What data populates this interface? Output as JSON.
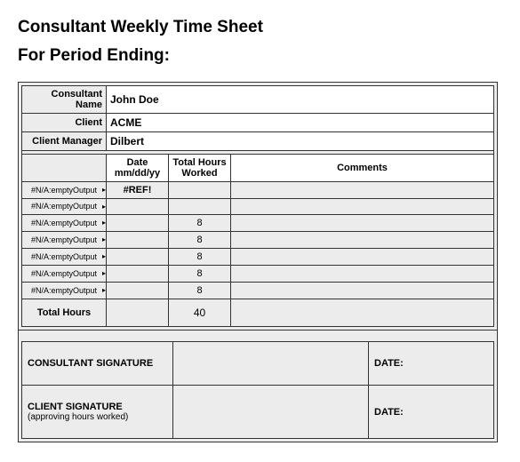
{
  "title": "Consultant Weekly Time Sheet",
  "subtitle": "For Period Ending:",
  "info": {
    "consultant_name_label": "Consultant Name",
    "consultant_name_value": "John Doe",
    "client_label": "Client",
    "client_value": "ACME",
    "client_manager_label": "Client Manager",
    "client_manager_value": "Dilbert"
  },
  "headers": {
    "date": "Date mm/dd/yy",
    "hours": "Total Hours Worked",
    "comments": "Comments"
  },
  "rows": [
    {
      "day": "#N/A:emptyOutput",
      "date": "#REF!",
      "hours": "",
      "comments": ""
    },
    {
      "day": "#N/A:emptyOutput",
      "date": "",
      "hours": "",
      "comments": ""
    },
    {
      "day": "#N/A:emptyOutput",
      "date": "",
      "hours": "8",
      "comments": ""
    },
    {
      "day": "#N/A:emptyOutput",
      "date": "",
      "hours": "8",
      "comments": ""
    },
    {
      "day": "#N/A:emptyOutput",
      "date": "",
      "hours": "8",
      "comments": ""
    },
    {
      "day": "#N/A:emptyOutput",
      "date": "",
      "hours": "8",
      "comments": ""
    },
    {
      "day": "#N/A:emptyOutput",
      "date": "",
      "hours": "8",
      "comments": ""
    }
  ],
  "totals": {
    "label": "Total Hours",
    "value": "40"
  },
  "signatures": {
    "consultant_label": "CONSULTANT SIGNATURE",
    "client_label": "CLIENT SIGNATURE",
    "client_sub": "(approving hours worked)",
    "date_label": "DATE:"
  }
}
